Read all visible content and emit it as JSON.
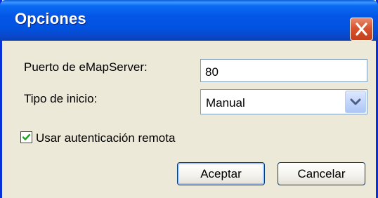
{
  "window": {
    "title": "Opciones",
    "close_icon": "close-icon"
  },
  "form": {
    "port_label": "Puerto de eMapServer:",
    "port_value": "80",
    "startup_label": "Tipo de inicio:",
    "startup_value": "Manual",
    "remote_auth_label": "Usar autenticación remota",
    "remote_auth_checked": true
  },
  "buttons": {
    "accept": "Aceptar",
    "cancel": "Cancelar"
  },
  "colors": {
    "titlebar": "#0456e6",
    "dialog_background": "#ece9d8",
    "close_button": "#d9532f",
    "field_border": "#7f9db9"
  }
}
